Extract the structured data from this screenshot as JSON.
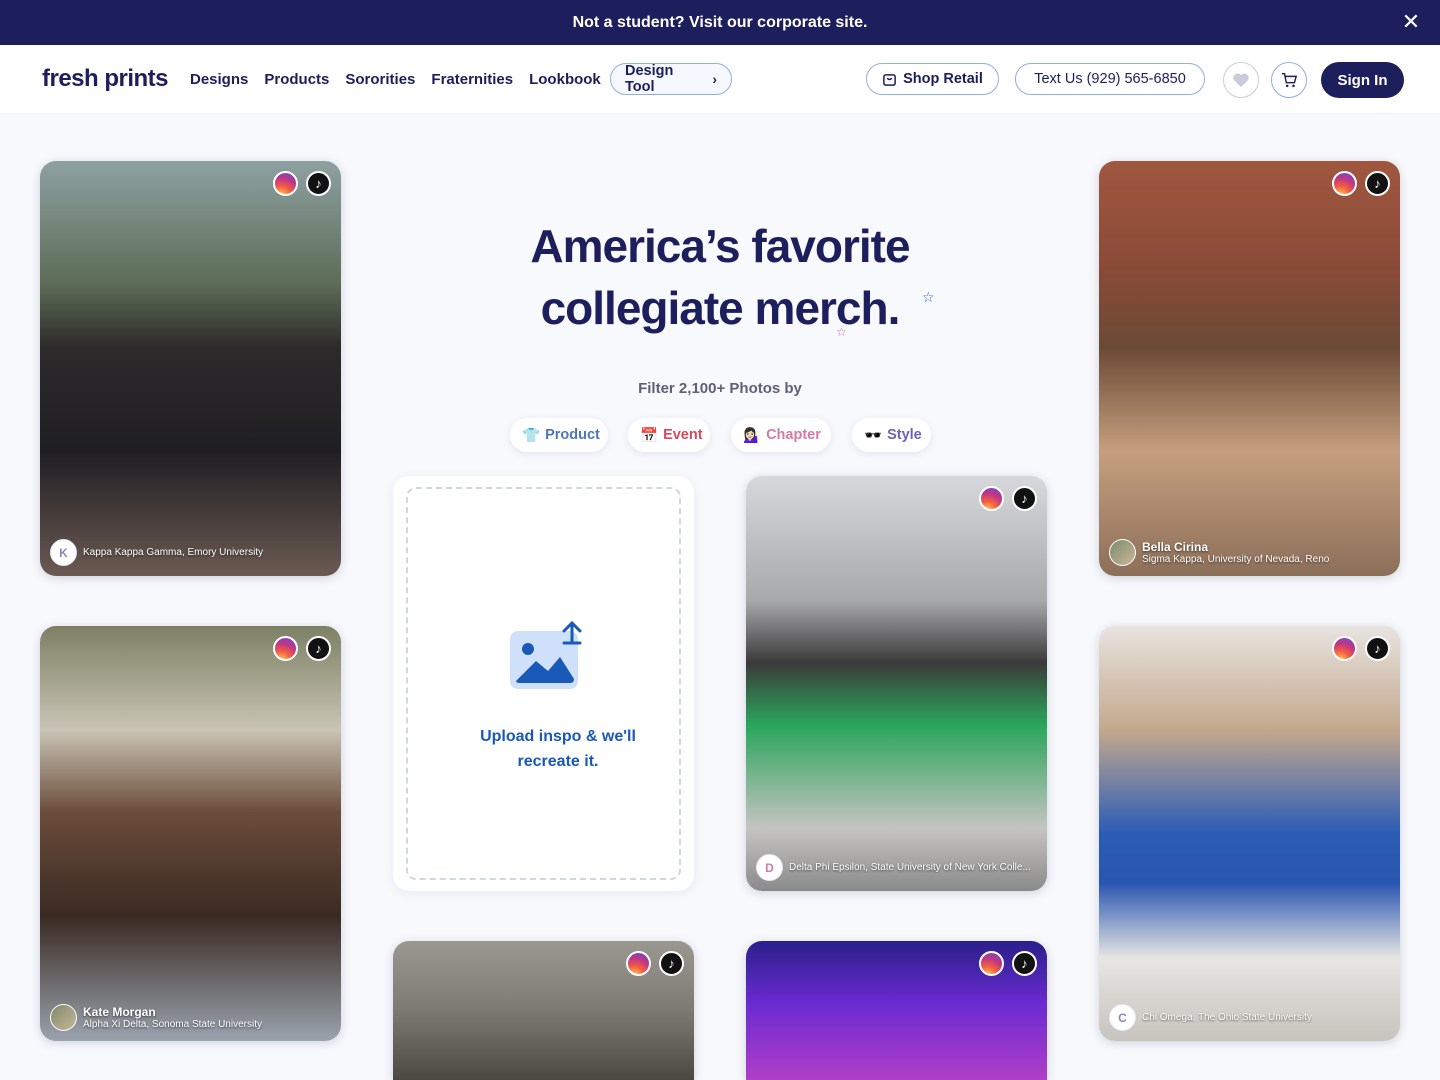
{
  "banner": {
    "text": "Not a student? Visit our corporate site.",
    "close": "✕"
  },
  "header": {
    "logo": "fresh prints",
    "nav": [
      "Designs",
      "Products",
      "Sororities",
      "Fraternities",
      "Lookbook"
    ],
    "design_tool": "Design Tool",
    "shop_retail": "Shop Retail",
    "text_us": "Text Us (929) 565-6850",
    "sign_in": "Sign In"
  },
  "hero": {
    "title_line1": "America’s favorite",
    "title_line2": "collegiate merch.",
    "filter_label": "Filter 2,100+ Photos by",
    "filters": [
      {
        "label": "Product",
        "emoji": "👕"
      },
      {
        "label": "Event",
        "emoji": "📅"
      },
      {
        "label": "Chapter",
        "emoji": "💁🏻‍♀️"
      },
      {
        "label": "Style",
        "emoji": "🕶️"
      }
    ]
  },
  "upload": {
    "text": "Upload inspo & we'll recreate it."
  },
  "cards": [
    {
      "avatar": "K",
      "name": "",
      "org": "Kappa Kappa Gamma, Emory University"
    },
    {
      "avatar": "",
      "name": "Kate Morgan",
      "org": "Alpha Xi Delta, Sonoma State University"
    },
    {
      "avatar": "D",
      "name": "",
      "org": "Delta Phi Epsilon, State University of New York Colle..."
    },
    {
      "avatar": "",
      "name": "Bella Cirina",
      "org": "Sigma Kappa, University of Nevada, Reno"
    },
    {
      "avatar": "C",
      "name": "",
      "org": "Chi Omega, The Ohio State University"
    }
  ],
  "colors": {
    "navy": "#1d1f5c",
    "accent_blue": "#1a59b8",
    "outline": "#8fb1dd"
  }
}
